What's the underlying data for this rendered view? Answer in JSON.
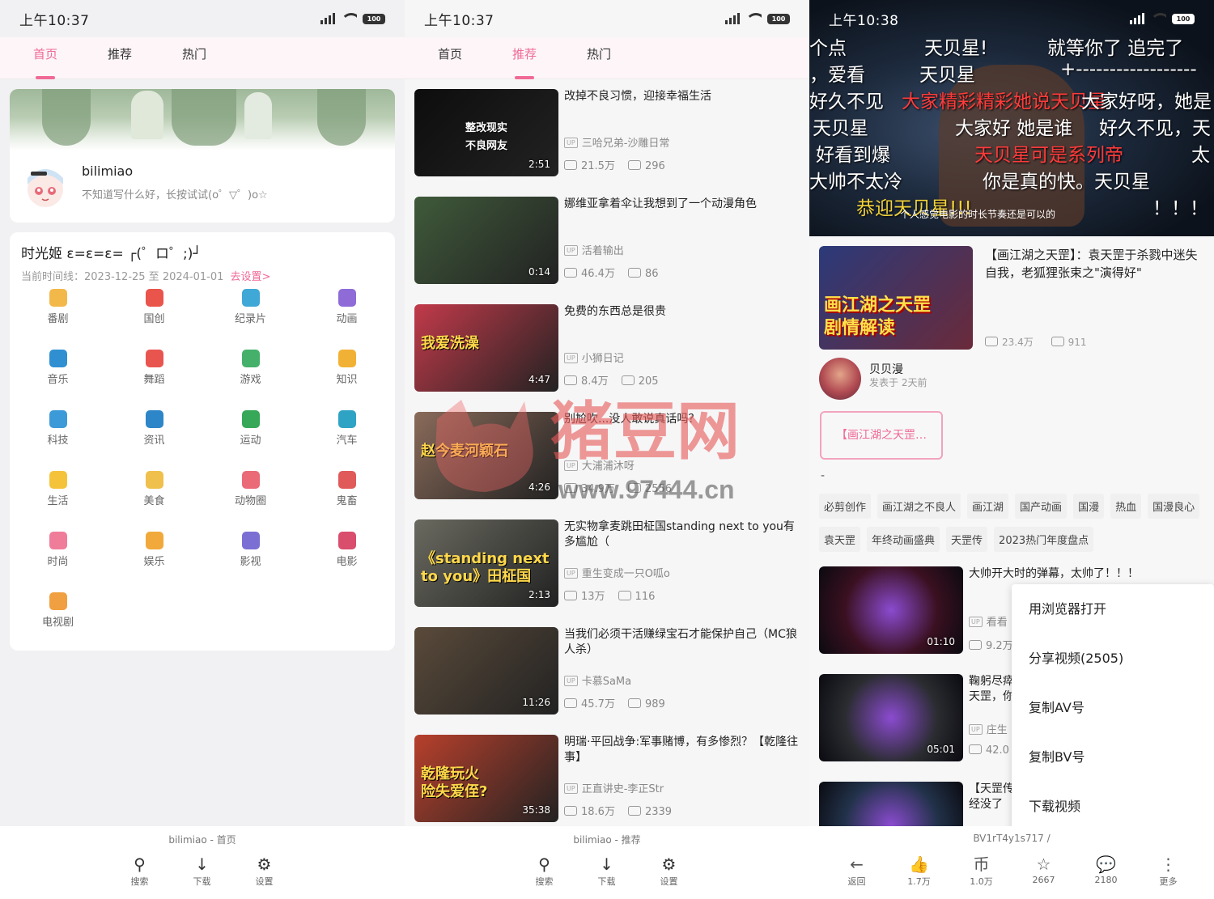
{
  "screens": [
    {
      "status": {
        "time": "上午10:37",
        "net": "HD",
        "battery": "100"
      },
      "tabs": [
        {
          "label": "首页",
          "active": true
        },
        {
          "label": "推荐",
          "active": false
        },
        {
          "label": "热门",
          "active": false
        }
      ],
      "profile": {
        "name": "bilimiao",
        "bio": "不知道写什么好，长按试试(o゜▽゜)o☆"
      },
      "timeline": {
        "title": "时光姬  ε=ε=ε= ┌(゜ロ゜;)┘",
        "range_prefix": "当前时间线：2023-12-25 至 2024-01-01",
        "set_link": "去设置>"
      },
      "categories": [
        {
          "label": "番剧",
          "color": "#f2b84a"
        },
        {
          "label": "国创",
          "color": "#e9544b"
        },
        {
          "label": "纪录片",
          "color": "#3fa8d6"
        },
        {
          "label": "动画",
          "color": "#8f6bd8"
        },
        {
          "label": "音乐",
          "color": "#2f8fd1"
        },
        {
          "label": "舞蹈",
          "color": "#e8554e"
        },
        {
          "label": "游戏",
          "color": "#45b06a"
        },
        {
          "label": "知识",
          "color": "#f1b134"
        },
        {
          "label": "科技",
          "color": "#3c9ad8"
        },
        {
          "label": "资讯",
          "color": "#2d86c7"
        },
        {
          "label": "运动",
          "color": "#36a857"
        },
        {
          "label": "汽车",
          "color": "#2fa3c4"
        },
        {
          "label": "生活",
          "color": "#f5c33a"
        },
        {
          "label": "美食",
          "color": "#f0c04c"
        },
        {
          "label": "动物圈",
          "color": "#ea6a78"
        },
        {
          "label": "鬼畜",
          "color": "#e05a5a"
        },
        {
          "label": "时尚",
          "color": "#ef7d9a"
        },
        {
          "label": "娱乐",
          "color": "#f0a93a"
        },
        {
          "label": "影视",
          "color": "#7b6fd3"
        },
        {
          "label": "电影",
          "color": "#d94d6d"
        },
        {
          "label": "电视剧",
          "color": "#f0a040"
        }
      ],
      "caption": "bilimiao - 首页",
      "nav": [
        {
          "label": "搜索",
          "icon": "search-icon",
          "glyph": "⚲"
        },
        {
          "label": "下载",
          "icon": "download-icon",
          "glyph": "↓"
        },
        {
          "label": "设置",
          "icon": "gear-icon",
          "glyph": "⚙"
        }
      ]
    },
    {
      "status": {
        "time": "上午10:37",
        "net": "HD",
        "battery": "100"
      },
      "tabs": [
        {
          "label": "首页",
          "active": false
        },
        {
          "label": "推荐",
          "active": true
        },
        {
          "label": "热门",
          "active": false
        }
      ],
      "videos": [
        {
          "title": "改掉不良习惯，迎接幸福生活",
          "up": "三哈兄弟-沙雕日常",
          "views": "21.5万",
          "danmaku": "296",
          "duration": "2:51",
          "thumb_text": "整改现实\n不良网友",
          "bg": "#0d0d0d"
        },
        {
          "title": "娜维亚拿着伞让我想到了一个动漫角色",
          "up": "活着输出",
          "views": "46.4万",
          "danmaku": "86",
          "duration": "0:14",
          "thumb_text": "",
          "bg": "#3f5a3a"
        },
        {
          "title": "免费的东西总是很贵",
          "up": "小狮日记",
          "views": "8.4万",
          "danmaku": "205",
          "duration": "4:47",
          "thumb_text": "我爱洗澡",
          "bg": "#c23a4a"
        },
        {
          "title": "别尬吹...没人敢说真话吗？",
          "up": "大浦浦沐呀",
          "views": "34.9万",
          "danmaku": "2556",
          "duration": "4:26",
          "thumb_text": "赵今麦河颖石",
          "bg": "#8a6b5a"
        },
        {
          "title": "无实物拿麦跳田柾国standing next to you有多尴尬（",
          "up": "重生变成一只O呱o",
          "views": "13万",
          "danmaku": "116",
          "duration": "2:13",
          "thumb_text": "《standing next to you》田柾国",
          "bg": "#6a6a60"
        },
        {
          "title": "当我们必须干活赚绿宝石才能保护自己（MC狼人杀）",
          "up": "卡慕SaMa",
          "views": "45.7万",
          "danmaku": "989",
          "duration": "11:26",
          "thumb_text": "",
          "bg": "#5a4a3a"
        },
        {
          "title": "明瑞·平回战争:军事赌博，有多惨烈？【乾隆往事】",
          "up": "正直讲史-李正Str",
          "views": "18.6万",
          "danmaku": "2339",
          "duration": "35:38",
          "thumb_text": "乾隆玩火\n险失爱侄?",
          "bg": "#b8402c"
        }
      ],
      "caption": "bilimiao - 推荐",
      "nav": [
        {
          "label": "搜索",
          "icon": "search-icon",
          "glyph": "⚲"
        },
        {
          "label": "下载",
          "icon": "download-icon",
          "glyph": "↓"
        },
        {
          "label": "设置",
          "icon": "gear-icon",
          "glyph": "⚙"
        }
      ]
    },
    {
      "status": {
        "time": "上午10:38",
        "net": "HD",
        "battery": "100"
      },
      "danmaku_lines": [
        {
          "text": "个点",
          "color": "#fff"
        },
        {
          "text": "天贝星!",
          "color": "#fff"
        },
        {
          "text": "就等你了 追完了",
          "color": "#fff"
        },
        {
          "text": "，爱看",
          "color": "#fff"
        },
        {
          "text": "天贝星",
          "color": "#fff"
        },
        {
          "text": "+------------------",
          "color": "#fff"
        },
        {
          "text": "好久不见",
          "color": "#fff"
        },
        {
          "text": "大家精彩精彩她说天贝星",
          "color": "#ff3b3b"
        },
        {
          "text": "大家好呀，她是",
          "color": "#fff"
        },
        {
          "text": "天贝星",
          "color": "#fff"
        },
        {
          "text": "大家好 她是谁",
          "color": "#fff"
        },
        {
          "text": "好久不见，天",
          "color": "#fff"
        },
        {
          "text": "好看到爆",
          "color": "#fff"
        },
        {
          "text": "天贝星可是系列帝",
          "color": "#ff3b3b"
        },
        {
          "text": "太",
          "color": "#fff"
        },
        {
          "text": "大帅不太冷",
          "color": "#fff"
        },
        {
          "text": "你是真的快。天贝星",
          "color": "#fff"
        },
        {
          "text": "恭迎天贝星!!!",
          "color": "#f2d33a"
        },
        {
          "text": "！！！",
          "color": "#fff"
        }
      ],
      "player_subtitle": "个人感觉电影的时长节奏还是可以的",
      "main_video": {
        "title": "【画江湖之天罡】：袁天罡于杀戮中迷失自我，老狐狸张束之\"演得好\"",
        "views": "23.4万",
        "danmaku": "911",
        "thumb_text": "画江湖之天罡\n剧情解读"
      },
      "author": {
        "name": "贝贝漫",
        "time": "发表于 2天前"
      },
      "collection_button": "【画江湖之天罡…",
      "dash": "-",
      "tags": [
        "必剪创作",
        "画江湖之不良人",
        "画江湖",
        "国产动画",
        "国漫",
        "热血",
        "国漫良心",
        "袁天罡",
        "年终动画盛典",
        "天罡传",
        "2023热门年度盘点"
      ],
      "related": [
        {
          "title": "大帅开大时的弹幕，太帅了！！！",
          "up": "看看",
          "views": "9.2万",
          "duration": "01:10",
          "bg": "#3a1020"
        },
        {
          "title": "鞠躬尽瘁 天罡，你",
          "up": "庄生",
          "views": "42.0",
          "duration": "05:01",
          "bg": "#2a2c30"
        },
        {
          "title": "【天罡传 经没了",
          "up": "",
          "views": "",
          "duration": "",
          "bg": "#22324a"
        }
      ],
      "context_menu": [
        "用浏览器打开",
        "分享视频(2505)",
        "复制AV号",
        "复制BV号",
        "下载视频"
      ],
      "caption": "BV1rT4y1s717 /",
      "actions": [
        {
          "label": "返回",
          "icon": "back-arrow-icon",
          "glyph": "←"
        },
        {
          "label": "1.7万",
          "icon": "like-icon",
          "glyph": "👍"
        },
        {
          "label": "1.0万",
          "icon": "coin-icon",
          "glyph": "币"
        },
        {
          "label": "2667",
          "icon": "star-icon",
          "glyph": "☆"
        },
        {
          "label": "2180",
          "icon": "comment-icon",
          "glyph": "💬"
        },
        {
          "label": "更多",
          "icon": "more-icon",
          "glyph": "⋮"
        }
      ]
    }
  ],
  "watermark": {
    "text": "猪豆网",
    "url": "www.97444.cn"
  }
}
